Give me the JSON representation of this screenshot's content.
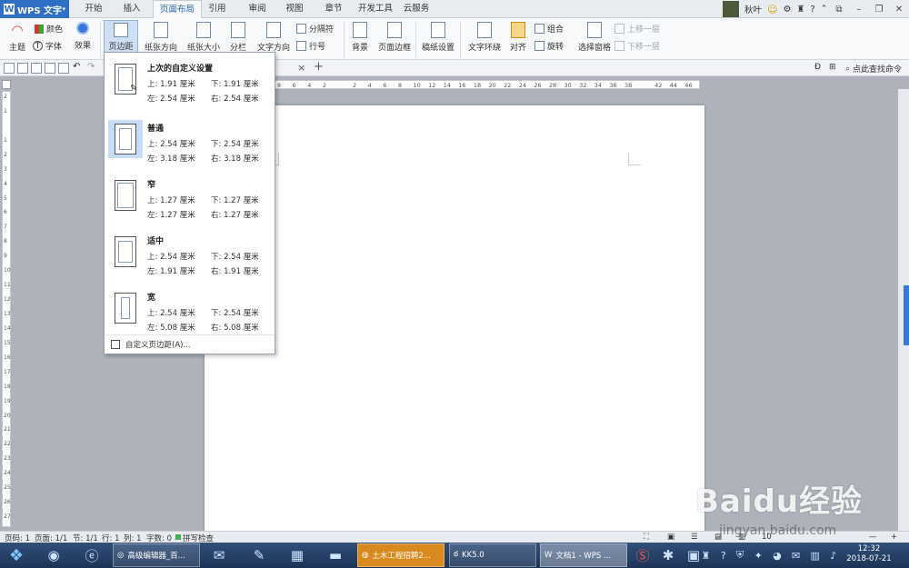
{
  "app": {
    "logo_text": "WPS 文字"
  },
  "tabs": [
    {
      "label": "开始"
    },
    {
      "label": "插入"
    },
    {
      "label": "页面布局",
      "active": true
    },
    {
      "label": "引用"
    },
    {
      "label": "审阅"
    },
    {
      "label": "视图"
    },
    {
      "label": "章节"
    },
    {
      "label": "开发工具"
    },
    {
      "label": "云服务"
    }
  ],
  "user": {
    "name": "秋叶"
  },
  "ribbon": {
    "theme": "主题",
    "colors": "颜色",
    "fonts": "字体",
    "effects": "效果",
    "margins": "页边距",
    "orientation": "纸张方向",
    "size": "纸张大小",
    "columns": "分栏",
    "text_direction": "文字方向",
    "breaks": "分隔符",
    "line_numbers": "行号",
    "background": "背景",
    "page_border": "页面边框",
    "grid_setup": "稿纸设置",
    "wrap_text": "文字环绕",
    "align": "对齐",
    "group": "组合",
    "rotate": "旋转",
    "selection_pane": "选择窗格",
    "bring_forward": "上移一层",
    "send_backward": "下移一层"
  },
  "qat": {
    "quick_search": "点此查找命令"
  },
  "ruler": {
    "h_ticks": [
      "8",
      "6",
      "4",
      "2",
      "",
      "2",
      "4",
      "6",
      "8",
      "10",
      "12",
      "14",
      "16",
      "18",
      "20",
      "22",
      "24",
      "26",
      "28",
      "30",
      "32",
      "34",
      "36",
      "38",
      "",
      "42",
      "44",
      "46"
    ],
    "v_ticks": [
      "2",
      "1",
      "",
      "1",
      "2",
      "3",
      "4",
      "5",
      "6",
      "7",
      "8",
      "9",
      "10",
      "11",
      "12",
      "13",
      "14",
      "15",
      "16",
      "17",
      "18",
      "19",
      "20",
      "21",
      "22",
      "23",
      "24",
      "25",
      "26",
      "27"
    ]
  },
  "margin_menu": {
    "options": [
      {
        "title": "上次的自定义设置",
        "top": "上: 1.91 厘米",
        "bottom": "下: 1.91 厘米",
        "left": "左: 2.54 厘米",
        "right": "右: 2.54 厘米"
      },
      {
        "title": "普通",
        "top": "上: 2.54 厘米",
        "bottom": "下: 2.54 厘米",
        "left": "左: 3.18 厘米",
        "right": "右: 3.18 厘米",
        "selected": true
      },
      {
        "title": "窄",
        "top": "上: 1.27 厘米",
        "bottom": "下: 1.27 厘米",
        "left": "左: 1.27 厘米",
        "right": "右: 1.27 厘米"
      },
      {
        "title": "适中",
        "top": "上: 2.54 厘米",
        "bottom": "下: 2.54 厘米",
        "left": "左: 1.91 厘米",
        "right": "右: 1.91 厘米"
      },
      {
        "title": "宽",
        "top": "上: 2.54 厘米",
        "bottom": "下: 2.54 厘米",
        "left": "左: 5.08 厘米",
        "right": "右: 5.08 厘米"
      }
    ],
    "custom": "自定义页边距(A)..."
  },
  "status": {
    "page": "页码: 1",
    "pages": "页面: 1/1",
    "section": "节: 1/1",
    "row": "行: 1",
    "col": "列: 1",
    "words": "字数: 0",
    "spell": "拼写检查",
    "zoom": "10"
  },
  "taskbar": {
    "tasks": [
      {
        "label": "高级编辑器_百..."
      },
      {
        "label": "土木工程招聘2..."
      },
      {
        "label": "KK5.0"
      },
      {
        "label": "文档1 - WPS ..."
      }
    ],
    "time": "12:32",
    "date": "2018-07-21"
  },
  "watermark": {
    "logo": "Baidu经验",
    "url": "jingyan.baidu.com"
  },
  "colors": {
    "accent": "#2f6fc4",
    "thumb": "#3a76d6",
    "menu_highlight": "#c9dcf5"
  }
}
